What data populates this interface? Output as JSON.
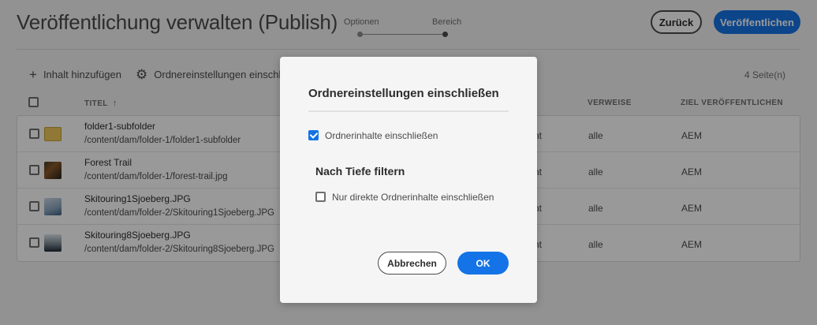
{
  "header": {
    "title": "Veröffentlichung verwalten (Publish)",
    "steps": [
      "Optionen",
      "Bereich"
    ],
    "back_label": "Zurück",
    "publish_label": "Veröffentlichen"
  },
  "toolbar": {
    "add_label": "Inhalt hinzufügen",
    "settings_label": "Ordnereinstellungen einschließ",
    "page_count": "4 Seite(n)"
  },
  "table": {
    "headers": {
      "title": "TITEL",
      "references": "VERWEISE",
      "target": "ZIEL VERÖFFENTLICHEN"
    },
    "rows": [
      {
        "title": "folder1-subfolder",
        "path": "/content/dam/folder-1/folder1-subfolder",
        "partial": "nt",
        "references": "alle",
        "target": "AEM"
      },
      {
        "title": "Forest Trail",
        "path": "/content/dam/folder-1/forest-trail.jpg",
        "partial": "nt",
        "references": "alle",
        "target": "AEM"
      },
      {
        "title": "Skitouring1Sjoeberg.JPG",
        "path": "/content/dam/folder-2/Skitouring1Sjoeberg.JPG",
        "partial": "nt",
        "references": "alle",
        "target": "AEM"
      },
      {
        "title": "Skitouring8Sjoeberg.JPG",
        "path": "/content/dam/folder-2/Skitouring8Sjoeberg.JPG",
        "partial": "nt",
        "references": "alle",
        "target": "AEM"
      }
    ]
  },
  "dialog": {
    "title": "Ordnereinstellungen einschließen",
    "include_contents_label": "Ordnerinhalte einschließen",
    "depth_title": "Nach Tiefe filtern",
    "direct_only_label": "Nur direkte Ordnerinhalte einschließen",
    "cancel_label": "Abbrechen",
    "ok_label": "OK"
  },
  "colors": {
    "accent": "#1473e6",
    "overlay": "rgba(0,0,0,0.4)"
  }
}
